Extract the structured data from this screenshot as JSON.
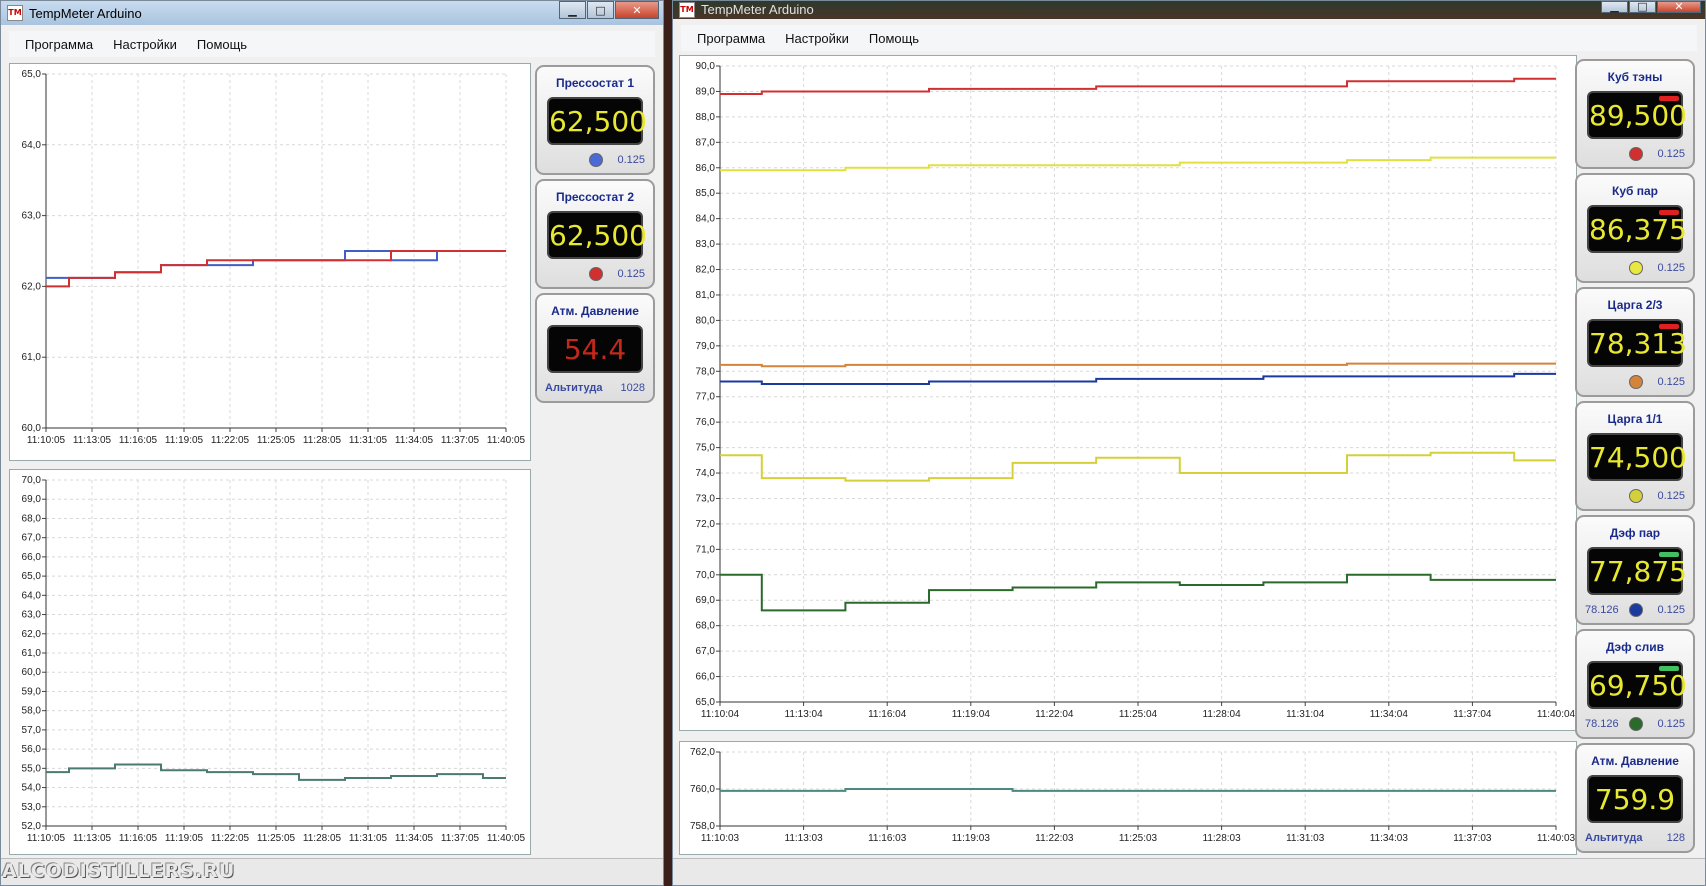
{
  "left_window": {
    "title": "TempMeter Arduino",
    "menu": [
      "Программа",
      "Настройки",
      "Помощь"
    ],
    "chart_top": {
      "yticks": [
        "65,0",
        "64,0",
        "63,0",
        "62,0",
        "61,0",
        "60,0"
      ],
      "xticks": [
        "11:10:05",
        "11:13:05",
        "11:16:05",
        "11:19:05",
        "11:22:05",
        "11:25:05",
        "11:28:05",
        "11:31:05",
        "11:34:05",
        "11:37:05",
        "11:40:05"
      ]
    },
    "chart_bottom": {
      "yticks": [
        "70,0",
        "69,0",
        "68,0",
        "67,0",
        "66,0",
        "65,0",
        "64,0",
        "63,0",
        "62,0",
        "61,0",
        "60,0",
        "59,0",
        "58,0",
        "57,0",
        "56,0",
        "55,0",
        "54,0",
        "53,0",
        "52,0"
      ],
      "xticks": [
        "11:10:05",
        "11:13:05",
        "11:16:05",
        "11:19:05",
        "11:22:05",
        "11:25:05",
        "11:28:05",
        "11:31:05",
        "11:34:05",
        "11:37:05",
        "11:40:05"
      ]
    },
    "sensors": [
      {
        "title": "Прессостат 1",
        "value": "62,500",
        "dot": "#4a6ad6",
        "step": "0.125"
      },
      {
        "title": "Прессостат 2",
        "value": "62,500",
        "dot": "#d03030",
        "step": "0.125"
      }
    ],
    "pressure": {
      "title": "Атм. Давление",
      "value": "54.4",
      "alt_label": "Альтитуда",
      "alt_value": "1028"
    }
  },
  "right_window": {
    "title": "TempMeter Arduino",
    "menu": [
      "Программа",
      "Настройки",
      "Помощь"
    ],
    "chart_main": {
      "yticks": [
        "90,0",
        "89,0",
        "88,0",
        "87,0",
        "86,0",
        "85,0",
        "84,0",
        "83,0",
        "82,0",
        "81,0",
        "80,0",
        "79,0",
        "78,0",
        "77,0",
        "76,0",
        "75,0",
        "74,0",
        "73,0",
        "72,0",
        "71,0",
        "70,0",
        "69,0",
        "68,0",
        "67,0",
        "66,0",
        "65,0"
      ],
      "xticks": [
        "11:10:04",
        "11:13:04",
        "11:16:04",
        "11:19:04",
        "11:22:04",
        "11:25:04",
        "11:28:04",
        "11:31:04",
        "11:34:04",
        "11:37:04",
        "11:40:04"
      ]
    },
    "chart_pressure": {
      "yticks": [
        "762,0",
        "760,0",
        "758,0"
      ],
      "xticks": [
        "11:10:03",
        "11:13:03",
        "11:16:03",
        "11:19:03",
        "11:22:03",
        "11:25:03",
        "11:28:03",
        "11:31:03",
        "11:34:03",
        "11:37:03",
        "11:40:03"
      ]
    },
    "sensors": [
      {
        "title": "Куб тэны",
        "value": "89,500",
        "dot": "#d03030",
        "step": "0.125",
        "ind": "#e02020",
        "left": ""
      },
      {
        "title": "Куб пар",
        "value": "86,375",
        "dot": "#e8e840",
        "step": "0.125",
        "ind": "#e02020",
        "left": ""
      },
      {
        "title": "Царга 2/3",
        "value": "78,313",
        "dot": "#d4843a",
        "step": "0.125",
        "ind": "#e02020",
        "left": ""
      },
      {
        "title": "Царга 1/1",
        "value": "74,500",
        "dot": "#d4d03a",
        "step": "0.125",
        "ind": "",
        "left": ""
      },
      {
        "title": "Дэф пар",
        "value": "77,875",
        "dot": "#1a3aa0",
        "step": "0.125",
        "ind": "#40c060",
        "left": "78.126"
      },
      {
        "title": "Дэф слив",
        "value": "69,750",
        "dot": "#2a6a2a",
        "step": "0.125",
        "ind": "#40c060",
        "left": "78.126"
      }
    ],
    "pressure": {
      "title": "Атм. Давление",
      "value": "759.9",
      "alt_label": "Альтитуда",
      "alt_value": "128"
    }
  },
  "watermark": "ALCODISTILLERS.RU",
  "chart_data": [
    {
      "type": "line",
      "title": "",
      "ylim": [
        60,
        65
      ],
      "x": [
        "11:10:05",
        "11:13:05",
        "11:16:05",
        "11:19:05",
        "11:22:05",
        "11:25:05",
        "11:28:05",
        "11:31:05",
        "11:34:05",
        "11:37:05",
        "11:40:05"
      ],
      "series": [
        {
          "color": "#4060c8",
          "values": [
            62.12,
            62.12,
            62.2,
            62.3,
            62.3,
            62.37,
            62.37,
            62.5,
            62.37,
            62.5,
            62.5
          ]
        },
        {
          "color": "#d03030",
          "values": [
            62.0,
            62.12,
            62.2,
            62.3,
            62.37,
            62.37,
            62.37,
            62.37,
            62.5,
            62.5,
            62.5
          ]
        }
      ]
    },
    {
      "type": "line",
      "title": "",
      "ylim": [
        52,
        70
      ],
      "x": [
        "11:10:05",
        "11:13:05",
        "11:16:05",
        "11:19:05",
        "11:22:05",
        "11:25:05",
        "11:28:05",
        "11:31:05",
        "11:34:05",
        "11:37:05",
        "11:40:05"
      ],
      "series": [
        {
          "color": "#4a7a70",
          "values": [
            54.8,
            55.0,
            55.2,
            54.9,
            54.8,
            54.7,
            54.4,
            54.5,
            54.6,
            54.7,
            54.5
          ]
        }
      ]
    },
    {
      "type": "line",
      "title": "",
      "ylim": [
        65,
        90
      ],
      "x": [
        "11:10:04",
        "11:13:04",
        "11:16:04",
        "11:19:04",
        "11:22:04",
        "11:25:04",
        "11:28:04",
        "11:31:04",
        "11:34:04",
        "11:37:04",
        "11:40:04"
      ],
      "series": [
        {
          "color": "#d03030",
          "values": [
            88.9,
            89.0,
            89.0,
            89.1,
            89.1,
            89.2,
            89.2,
            89.2,
            89.4,
            89.4,
            89.5
          ]
        },
        {
          "color": "#e0e040",
          "values": [
            85.9,
            85.9,
            86.0,
            86.1,
            86.1,
            86.1,
            86.2,
            86.2,
            86.3,
            86.4,
            86.4
          ]
        },
        {
          "color": "#d4843a",
          "values": [
            78.25,
            78.2,
            78.25,
            78.25,
            78.25,
            78.25,
            78.25,
            78.25,
            78.3,
            78.3,
            78.3
          ]
        },
        {
          "color": "#1a3aa0",
          "values": [
            77.6,
            77.5,
            77.5,
            77.6,
            77.6,
            77.7,
            77.7,
            77.8,
            77.8,
            77.8,
            77.9
          ]
        },
        {
          "color": "#d4d03a",
          "values": [
            74.7,
            73.8,
            73.7,
            73.8,
            74.4,
            74.6,
            74.0,
            74.0,
            74.7,
            74.8,
            74.5
          ]
        },
        {
          "color": "#2a6a2a",
          "values": [
            70.0,
            68.6,
            68.9,
            69.4,
            69.5,
            69.7,
            69.6,
            69.7,
            70.0,
            69.8,
            69.8
          ]
        }
      ]
    },
    {
      "type": "line",
      "title": "",
      "ylim": [
        758,
        762
      ],
      "x": [
        "11:10:03",
        "11:13:03",
        "11:16:03",
        "11:19:03",
        "11:22:03",
        "11:25:03",
        "11:28:03",
        "11:31:03",
        "11:34:03",
        "11:37:03",
        "11:40:03"
      ],
      "series": [
        {
          "color": "#4a8a80",
          "values": [
            759.9,
            759.9,
            760.0,
            760.0,
            759.9,
            759.9,
            759.9,
            759.9,
            759.9,
            759.9,
            759.9
          ]
        }
      ]
    }
  ]
}
